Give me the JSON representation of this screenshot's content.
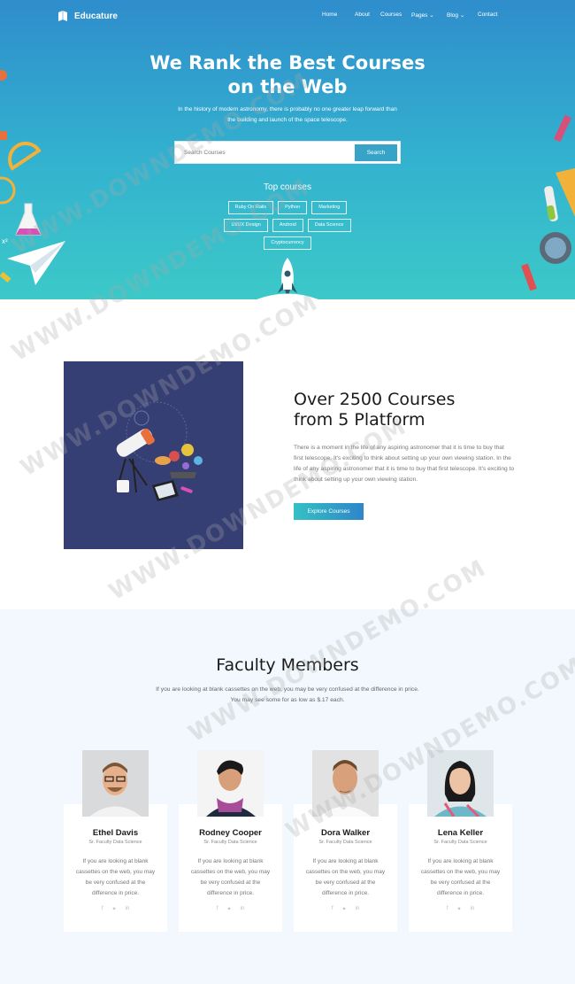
{
  "brand": {
    "name": "Educature"
  },
  "nav": {
    "items": [
      {
        "label": "Home",
        "active": true
      },
      {
        "label": "About"
      },
      {
        "label": "Courses"
      },
      {
        "label": "Pages",
        "dropdown": true
      },
      {
        "label": "Blog",
        "dropdown": true
      },
      {
        "label": "Contact"
      }
    ]
  },
  "hero": {
    "title_line1": "We Rank the Best Courses",
    "title_line2": "on the Web",
    "subtitle_line1": "In the history of modern astronomy, there is probably no one greater leap forward than",
    "subtitle_line2": "the building and launch of the space telescope.",
    "search_placeholder": "Search Courses",
    "search_button": "Search",
    "top_courses_title": "Top courses",
    "tags": [
      "Ruby On Rails",
      "Python",
      "Marketing",
      "UI/UX Design",
      "Android",
      "Data Science",
      "Cryptocurrency"
    ]
  },
  "about": {
    "title_line1": "Over 2500 Courses",
    "title_line2": "from 5 Platform",
    "text": "There is a moment in the life of any aspiring astronomer that it is time to buy that first telescope. It's exciting to think about setting up your own viewing station. In the life of any aspiring astronomer that it is time to buy that first telescope. It's exciting to think about setting up your own viewing station.",
    "button": "Explore Courses"
  },
  "faculty": {
    "title": "Faculty Members",
    "subtitle_line1": "If you are looking at blank cassettes on the web, you may be very confused at the difference in price.",
    "subtitle_line2": "You may see some for as low as $.17 each.",
    "members": [
      {
        "name": "Ethel Davis",
        "role": "Sr. Faculty Data Science",
        "text": "If you are looking at blank cassettes on the web, you may be very confused at the difference in price."
      },
      {
        "name": "Rodney Cooper",
        "role": "Sr. Faculty Data Science",
        "text": "If you are looking at blank cassettes on the web, you may be very confused at the difference in price."
      },
      {
        "name": "Dora Walker",
        "role": "Sr. Faculty Data Science",
        "text": "If you are looking at blank cassettes on the web, you may be very confused at the difference in price."
      },
      {
        "name": "Lena Keller",
        "role": "Sr. Faculty Data Science",
        "text": "If you are looking at blank cassettes on the web, you may be very confused at the difference in price."
      }
    ],
    "social_icons": [
      "facebook-icon",
      "twitter-icon",
      "linkedin-icon"
    ]
  },
  "watermark": "WWW.DOWNDEMO.COM",
  "colors": {
    "hero_top": "#2f8dcc",
    "hero_bottom": "#3cc9c8",
    "accent": "#37a4c7",
    "faculty_bg": "#f2f8fd",
    "about_image_bg": "#363f73"
  }
}
